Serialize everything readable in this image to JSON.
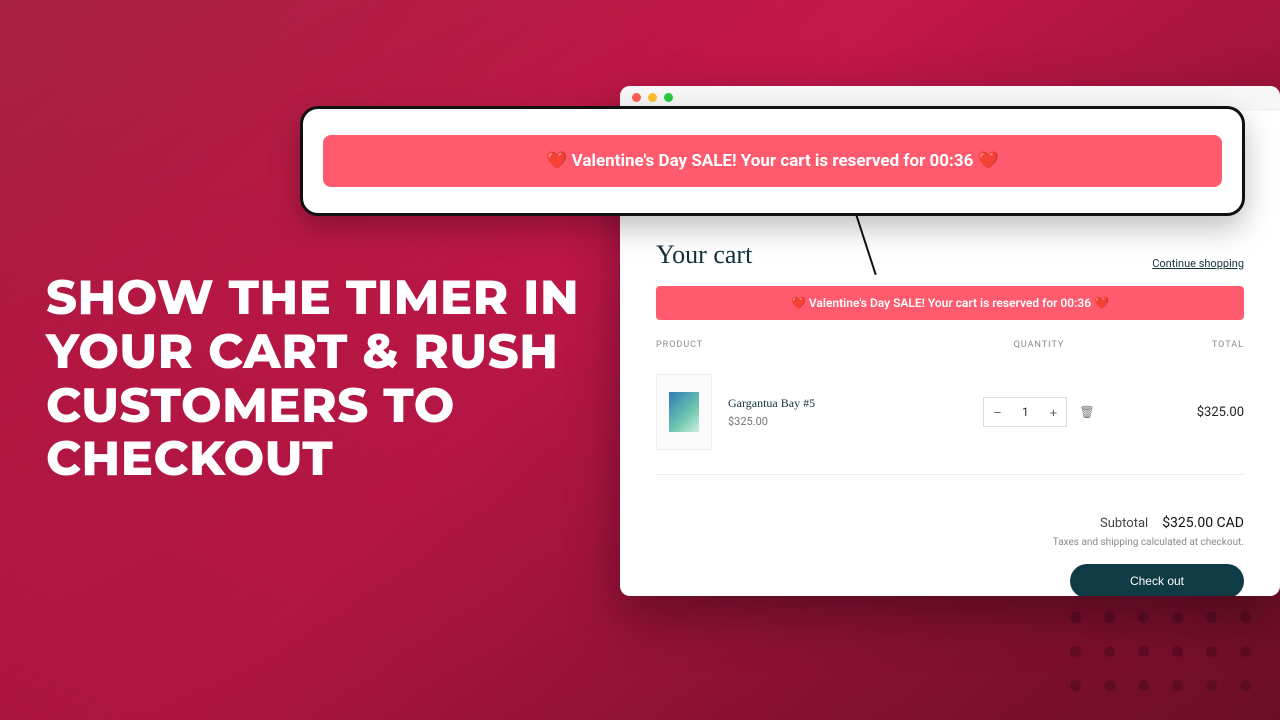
{
  "headline": "SHOW THE TIMER IN YOUR CART  & RUSH CUSTOMERS TO CHECKOUT",
  "callout_timer": "❤️ Valentine's Day SALE! Your cart is reserved for 00:36 ❤️",
  "cart": {
    "title": "Your cart",
    "continue_label": "Continue shopping",
    "inner_timer": "❤️ Valentine's Day SALE! Your cart is reserved for 00:36 ❤️",
    "columns": {
      "product": "PRODUCT",
      "quantity": "QUANTITY",
      "total": "TOTAL"
    },
    "item": {
      "name": "Gargantua Bay #5",
      "price": "$325.00",
      "qty": "1",
      "line_total": "$325.00"
    },
    "subtotal_label": "Subtotal",
    "subtotal_value": "$325.00 CAD",
    "tax_note": "Taxes and shipping calculated at checkout.",
    "checkout_label": "Check out"
  }
}
